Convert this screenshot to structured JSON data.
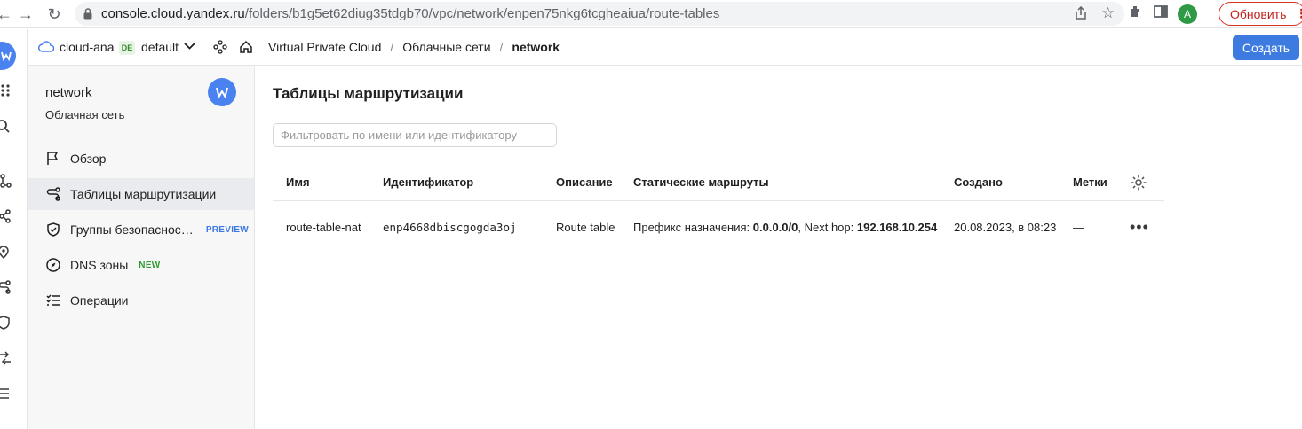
{
  "browser": {
    "url_host": "console.cloud.yandex.ru",
    "url_path": "/folders/b1g5et62diug35tdgb70/vpc/network/enpen75nkg6tcgheaiua/route-tables",
    "profile_initial": "A",
    "update_label": "Обновить"
  },
  "header": {
    "cloud": "cloud-ana",
    "folder_badge": "DE",
    "folder": "default",
    "breadcrumbs": [
      "Virtual Private Cloud",
      "Облачные сети",
      "network"
    ],
    "create_label": "Создать"
  },
  "sidebar": {
    "title": "network",
    "subtitle": "Облачная сеть",
    "items": [
      {
        "label": "Обзор",
        "icon": "flag-icon"
      },
      {
        "label": "Таблицы маршрутизации",
        "icon": "route-icon"
      },
      {
        "label": "Группы безопаснос…",
        "icon": "shield-icon",
        "badge": "PREVIEW"
      },
      {
        "label": "DNS зоны",
        "icon": "compass-icon",
        "badge": "NEW"
      },
      {
        "label": "Операции",
        "icon": "list-icon"
      }
    ]
  },
  "main": {
    "title": "Таблицы маршрутизации",
    "filter_placeholder": "Фильтровать по имени или идентификатору",
    "columns": [
      "Имя",
      "Идентификатор",
      "Описание",
      "Статические маршруты",
      "Создано",
      "Метки"
    ],
    "rows": [
      {
        "name": "route-table-nat",
        "id": "enp4668dbiscgogda3oj",
        "description": "Route table",
        "routes_prefix_label": "Префикс назначения: ",
        "routes_prefix": "0.0.0.0/0",
        "routes_sep": ", Next hop: ",
        "routes_next_hop": "192.168.10.254",
        "created": "20.08.2023, в 08:23",
        "labels": "—"
      }
    ]
  },
  "colors": {
    "accent": "#3d7be0",
    "new_badge": "#2f9a2f",
    "update_red": "#d93025"
  }
}
